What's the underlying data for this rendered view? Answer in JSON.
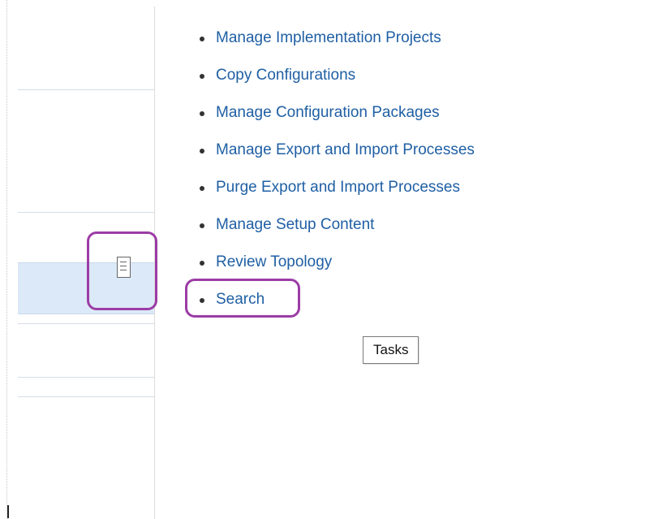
{
  "tasks_panel": {
    "items": [
      {
        "label": "Manage Implementation Projects"
      },
      {
        "label": "Copy Configurations"
      },
      {
        "label": "Manage Configuration Packages"
      },
      {
        "label": "Manage Export and Import Processes"
      },
      {
        "label": "Purge Export and Import Processes"
      },
      {
        "label": "Manage Setup Content"
      },
      {
        "label": "Review Topology"
      },
      {
        "label": "Search"
      }
    ],
    "highlighted_item": "Search"
  },
  "tasks_icon": {
    "icon": "document-icon",
    "tooltip": "Tasks"
  },
  "colors": {
    "link": "#1f5fa4",
    "highlight_outline": "#9c3ca6",
    "selected_row": "#dce9f8"
  }
}
